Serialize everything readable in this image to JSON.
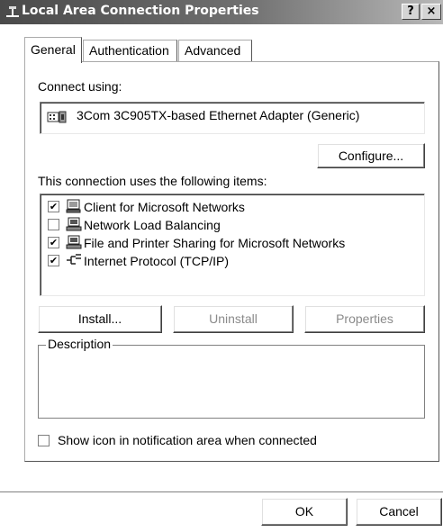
{
  "window": {
    "title": "Local Area Connection Properties",
    "help_button": "?",
    "close_button": "×"
  },
  "tabs": [
    {
      "label": "General",
      "active": true
    },
    {
      "label": "Authentication",
      "active": false
    },
    {
      "label": "Advanced",
      "active": false
    }
  ],
  "general": {
    "connect_using_label": "Connect using:",
    "adapter_name": "3Com 3C905TX-based Ethernet Adapter (Generic)",
    "configure_button": "Configure...",
    "items_label": "This connection uses the following items:",
    "items": [
      {
        "label": "Client for Microsoft Networks",
        "checked": true,
        "icon": "network-client-icon"
      },
      {
        "label": "Network Load Balancing",
        "checked": false,
        "icon": "network-service-icon"
      },
      {
        "label": "File and Printer Sharing for Microsoft Networks",
        "checked": true,
        "icon": "network-service-icon"
      },
      {
        "label": "Internet Protocol (TCP/IP)",
        "checked": true,
        "icon": "protocol-icon"
      }
    ],
    "install_button": "Install...",
    "uninstall_button": "Uninstall",
    "properties_button": "Properties",
    "description_label": "Description",
    "show_icon_label": "Show icon in notification area when connected",
    "show_icon_checked": false
  },
  "footer": {
    "ok_button": "OK",
    "cancel_button": "Cancel"
  },
  "colors": {
    "title_gradient_start": "#4a4a4a",
    "title_gradient_end": "#b8b8b8",
    "disabled_text": "#8a8a8a"
  }
}
